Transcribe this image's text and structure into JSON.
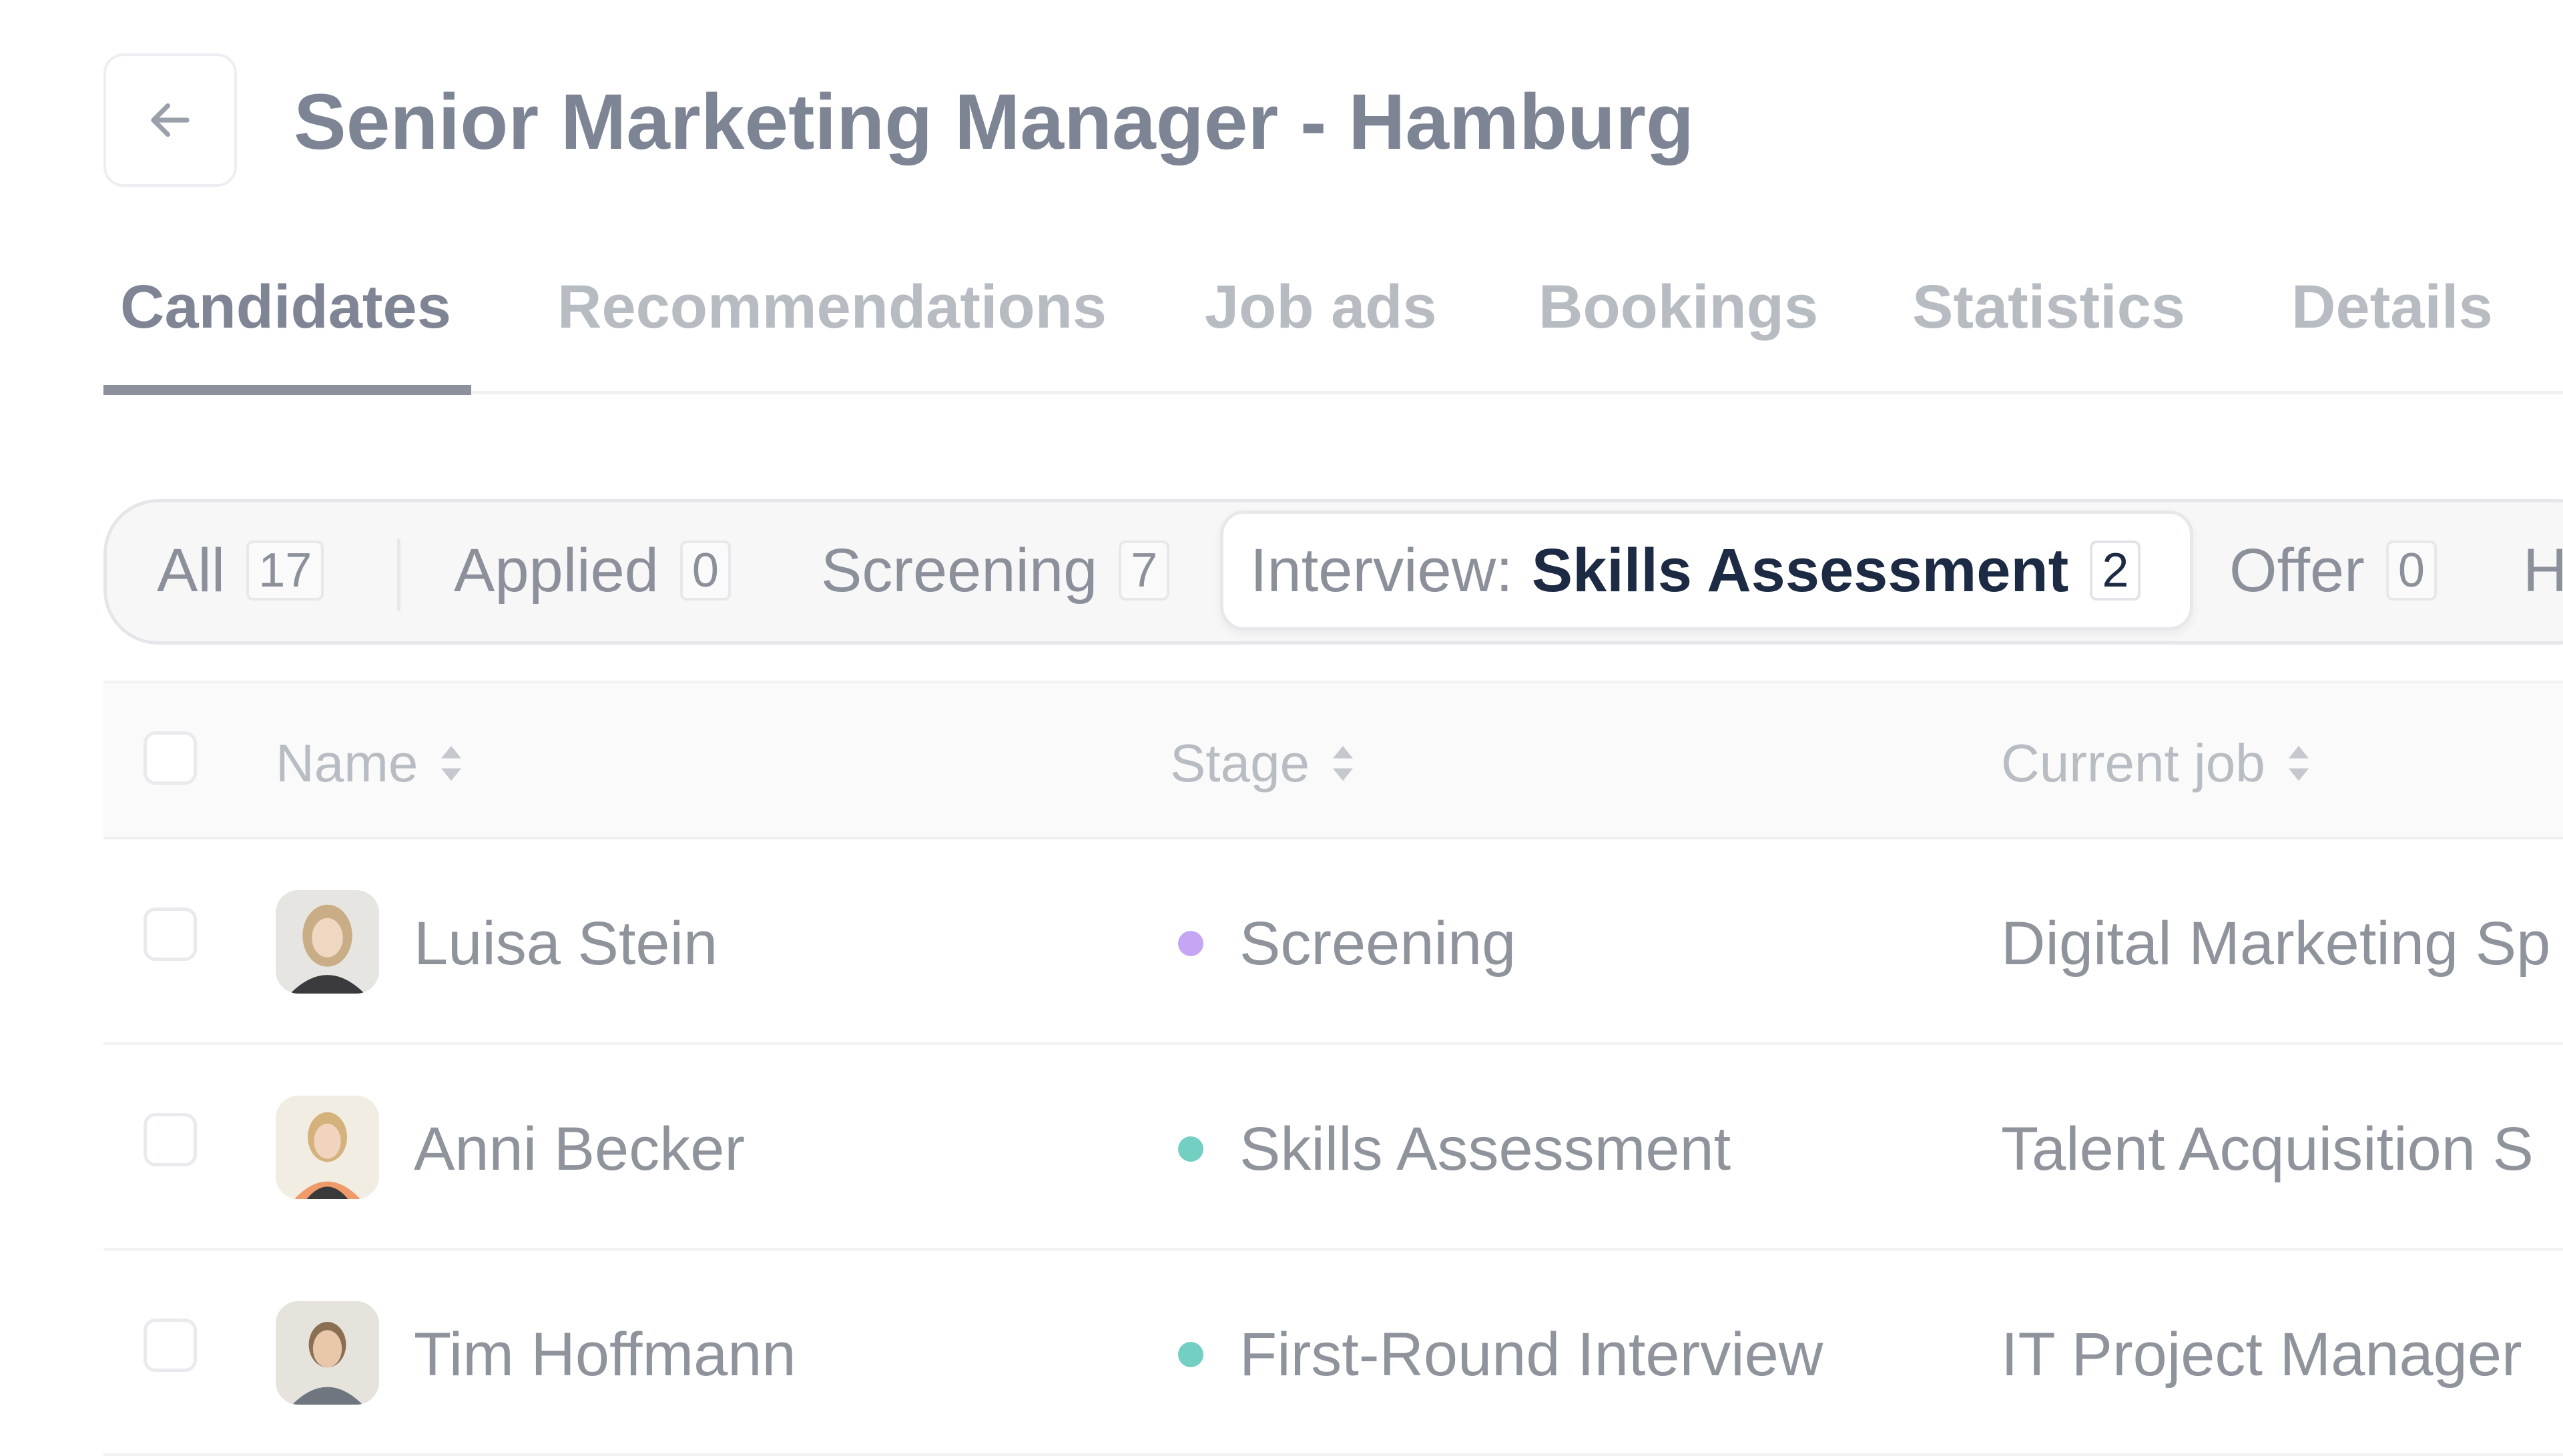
{
  "header": {
    "back_icon": "arrow-left-icon",
    "title": "Senior Marketing Manager - Hamburg"
  },
  "tabs": [
    {
      "label": "Candidates",
      "active": true
    },
    {
      "label": "Recommendations"
    },
    {
      "label": "Job ads"
    },
    {
      "label": "Bookings"
    },
    {
      "label": "Statistics"
    },
    {
      "label": "Details"
    }
  ],
  "stage_filter": {
    "all": {
      "label": "All",
      "count": "17"
    },
    "applied": {
      "label": "Applied",
      "count": "0"
    },
    "screening": {
      "label": "Screening",
      "count": "7"
    },
    "interview": {
      "prefix": "Interview:",
      "label": "Skills Assessment",
      "count": "2",
      "active": true
    },
    "offer": {
      "label": "Offer",
      "count": "0"
    },
    "next_partial": "H"
  },
  "table": {
    "columns": {
      "name": "Name",
      "stage": "Stage",
      "current_job": "Current job"
    },
    "rows": [
      {
        "name": "Luisa Stein",
        "stage": "Screening",
        "stage_color": "#c4a6f5",
        "current_job": "Digital Marketing Sp"
      },
      {
        "name": "Anni Becker",
        "stage": "Skills Assessment",
        "stage_color": "#74cfc3",
        "current_job": "Talent Acquisition S"
      },
      {
        "name": "Tim Hoffmann",
        "stage": "First-Round Interview",
        "stage_color": "#74cfc3",
        "current_job": "IT Project Manager"
      }
    ]
  }
}
